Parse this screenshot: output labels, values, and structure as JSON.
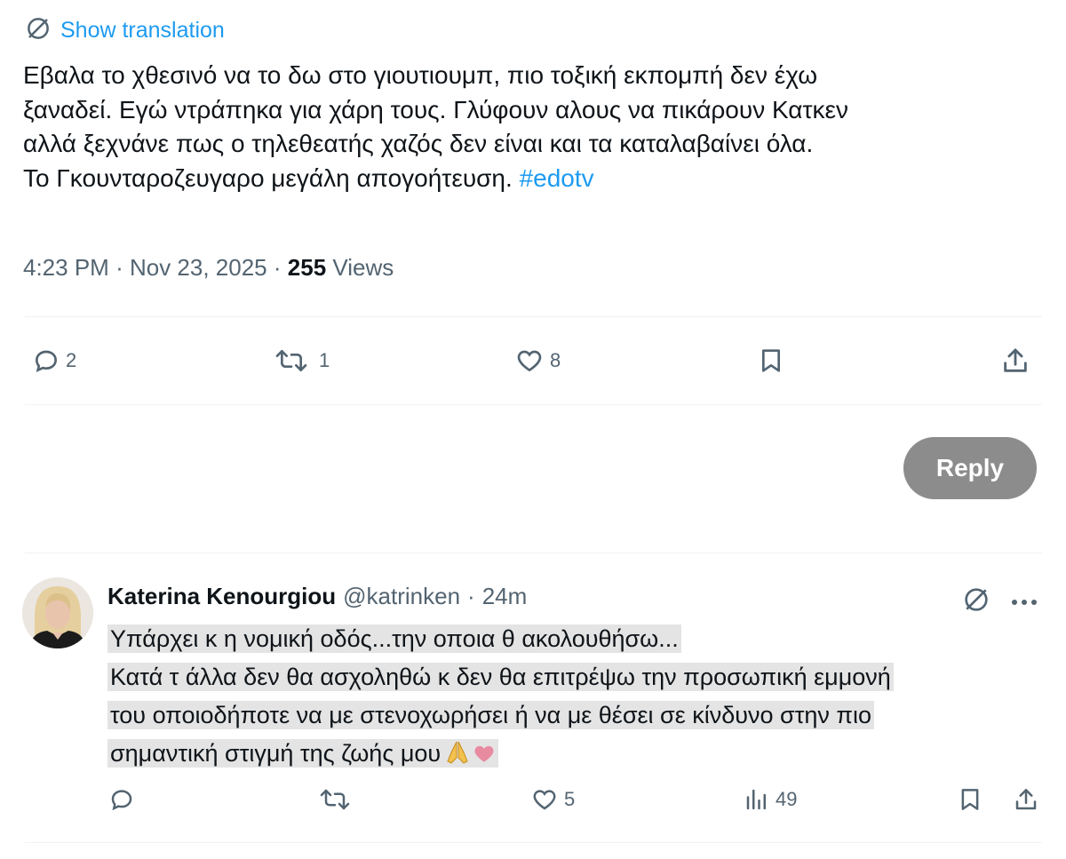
{
  "translation": {
    "label": "Show translation",
    "icon": "globe-slash-icon"
  },
  "tweet": {
    "lines": [
      "Εβαλα το χθεσινό να το δω στο γιουτιουμπ, πιο τοξική εκπομπή δεν έχω",
      "ξαναδεί. Εγώ ντράπηκα για χάρη τους. Γλύφουν αλους να πικάρουν Κατκεν",
      "αλλά ξεχνάνε  πως ο τηλεθεατής χαζός δεν είναι και τα καταλαβαίνει όλα.",
      "Το Γκουνταροζευγαρο μεγάλη απογοήτευση."
    ],
    "hashtag": "#edotv",
    "time": "4:23 PM",
    "date": "Nov 23, 2025",
    "views_count": "255",
    "views_label": "Views",
    "separator": "·"
  },
  "actions": {
    "replies": "2",
    "retweets": "1",
    "likes": "8"
  },
  "reply_button": "Reply",
  "reply": {
    "name": "Katerina Kenourgiou",
    "handle": "@katrinken",
    "separator": "·",
    "time": "24m",
    "lines": [
      "Υπάρχει κ η νομική οδός...την οποια θ ακολουθήσω...",
      "Κατά τ άλλα δεν θα ασχοληθώ κ δεν θα επιτρέψω την προσωπική εμμονή",
      "του οποιοδήποτε να με στενοχωρήσει ή να με θέσει σε κίνδυνο στην πιο",
      "σημαντική στιγμή της ζωής μου"
    ],
    "actions": {
      "replies": "",
      "retweets": "",
      "likes": "5",
      "views": "49"
    }
  },
  "colors": {
    "link": "#1d9bf0",
    "muted": "#536471",
    "reply_button_bg": "#8c8c8c",
    "highlight": "#e4e4e4"
  }
}
